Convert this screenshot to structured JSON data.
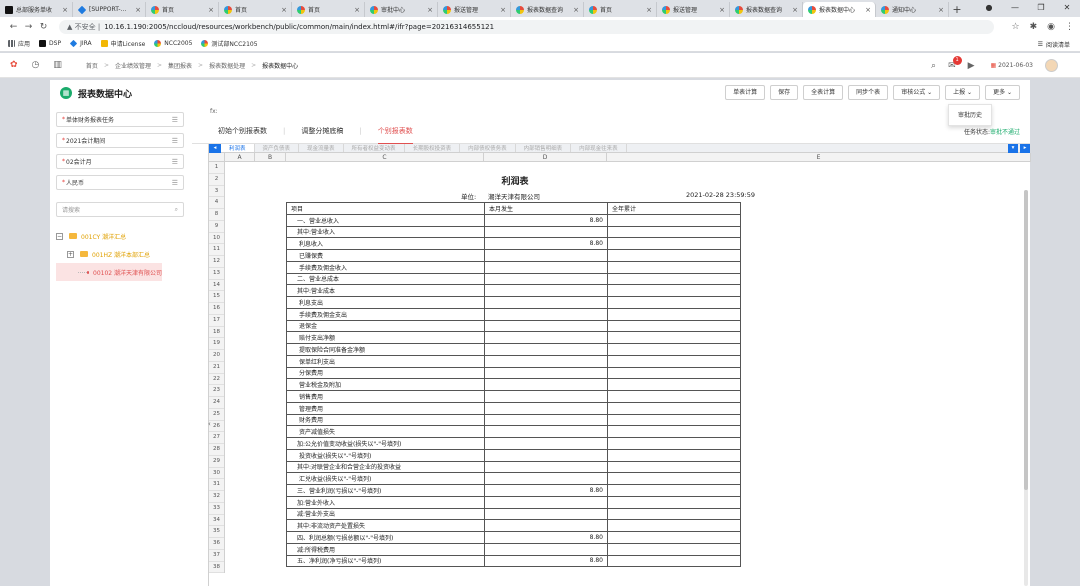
{
  "browser": {
    "tabs": [
      {
        "icon": "pm",
        "title": "总部服务单收"
      },
      {
        "icon": "sup",
        "title": "[SUPPORT-..."
      },
      {
        "icon": "ycs",
        "title": "首页"
      },
      {
        "icon": "ycs",
        "title": "首页"
      },
      {
        "icon": "ycs",
        "title": "首页"
      },
      {
        "icon": "ycs",
        "title": "审批中心"
      },
      {
        "icon": "ycs",
        "title": "报送管理"
      },
      {
        "icon": "ycs",
        "title": "报表数据查询"
      },
      {
        "icon": "ycs",
        "title": "首页"
      },
      {
        "icon": "ycs",
        "title": "报送管理"
      },
      {
        "icon": "ycs",
        "title": "报表数据查询"
      },
      {
        "icon": "ycs",
        "title": "报表数据中心",
        "active": true
      },
      {
        "icon": "ycs",
        "title": "通知中心"
      }
    ],
    "close_glyph": "×",
    "new_tab_glyph": "+",
    "url_warning": "▲ 不安全 |",
    "url": "10.16.1.190:2005/nccloud/resources/workbench/public/common/main/index.html#/ifr?page=20216314655121",
    "bookmarks": [
      {
        "icon": "apps",
        "label": "应用"
      },
      {
        "icon": "pm",
        "label": "DSP"
      },
      {
        "icon": "sup",
        "label": "JIRA"
      },
      {
        "icon": "yellow",
        "label": "申请License"
      },
      {
        "icon": "ycs",
        "label": "NCC2005"
      },
      {
        "icon": "ycs",
        "label": "测试部NCC2105"
      }
    ],
    "reading_list": "阅读清单"
  },
  "app": {
    "breadcrumbs": [
      "首页",
      "企业绩效管理",
      "集团报表",
      "报表数据处理",
      "报表数据中心"
    ],
    "notification_count": "1",
    "date": "2021-06-03"
  },
  "panel": {
    "title": "报表数据中心",
    "toolbar": [
      "单表计算",
      "保存",
      "全表计算",
      "同步个表",
      "审核公式 ⌄",
      "上报 ⌄",
      "更多 ⌄"
    ],
    "dropdown_item": "审批历史"
  },
  "sidebar": {
    "fields": [
      {
        "req": "*",
        "value": "单体财务报表任务"
      },
      {
        "req": "*",
        "value": "2021会计期间"
      },
      {
        "req": "*",
        "value": "02会计月"
      },
      {
        "req": "*",
        "value": "人民币"
      }
    ],
    "search_placeholder": "请搜索",
    "tree": [
      {
        "toggle": "−",
        "label": "001CY 潮洋汇总",
        "level": 0
      },
      {
        "toggle": "+",
        "label": "001HZ 潮洋本部汇总",
        "level": 1
      },
      {
        "toggle": "",
        "label": "00102 潮洋天津有限公司",
        "level": 2,
        "selected": true
      }
    ]
  },
  "content": {
    "fx_label": "fx:",
    "report_tabs": [
      "初始个别报表数",
      "调整分摊底稿",
      "个别报表数"
    ],
    "active_report_tab": 2,
    "task_status_label": "任务状态:",
    "task_status_value": "审批不通过",
    "sheet_tabs": [
      "利润表",
      "资产负债表",
      "现金流量表",
      "所有者权益变动表",
      "长期股权投资表",
      "内部债权债务表",
      "内部销售明细表",
      "内部现金往来表"
    ],
    "columns": [
      "A",
      "B",
      "C",
      "D",
      "E"
    ],
    "row_numbers": [
      "1",
      "2",
      "3",
      "4",
      "8",
      "9",
      "10",
      "11",
      "12",
      "13",
      "14",
      "15",
      "16",
      "17",
      "18",
      "19",
      "20",
      "21",
      "22",
      "23",
      "24",
      "25",
      "26",
      "27",
      "28",
      "29",
      "30",
      "31",
      "32",
      "33",
      "34",
      "35",
      "36",
      "37",
      "38"
    ]
  },
  "report": {
    "title": "利润表",
    "unit_label": "单位:",
    "unit_value": "潮洋天津有限公司",
    "datetime": "2021-02-28 23:59:59",
    "headers": [
      "项目",
      "本月发生",
      "全年累计"
    ],
    "rows": [
      [
        "一、营业总收入",
        "8.80",
        ""
      ],
      [
        "其中:营业收入",
        "",
        ""
      ],
      [
        "利息收入",
        "8.80",
        ""
      ],
      [
        "已赚保费",
        "",
        ""
      ],
      [
        "手续费及佣金收入",
        "",
        ""
      ],
      [
        "二、营业总成本",
        "",
        ""
      ],
      [
        "其中:营业成本",
        "",
        ""
      ],
      [
        "利息支出",
        "",
        ""
      ],
      [
        "手续费及佣金支出",
        "",
        ""
      ],
      [
        "退保金",
        "",
        ""
      ],
      [
        "赔付支出净额",
        "",
        ""
      ],
      [
        "提取保险合同准备金净额",
        "",
        ""
      ],
      [
        "保单红利支出",
        "",
        ""
      ],
      [
        "分保费用",
        "",
        ""
      ],
      [
        "营业税金及附加",
        "",
        ""
      ],
      [
        "销售费用",
        "",
        ""
      ],
      [
        "管理费用",
        "",
        ""
      ],
      [
        "财务费用",
        "",
        ""
      ],
      [
        "资产减值损失",
        "",
        ""
      ],
      [
        "加:公允价值变动收益(损失以\"-\"号填列)",
        "",
        ""
      ],
      [
        "投资收益(损失以\"-\"号填列)",
        "",
        ""
      ],
      [
        "其中:对联营企业和合营企业的投资收益",
        "",
        ""
      ],
      [
        "汇兑收益(损失以\"-\"号填列)",
        "",
        ""
      ],
      [
        "三、营业利润(亏损以\"-\"号填列)",
        "8.80",
        ""
      ],
      [
        "加:营业外收入",
        "",
        ""
      ],
      [
        "减:营业外支出",
        "",
        ""
      ],
      [
        "其中:非流动资产处置损失",
        "",
        ""
      ],
      [
        "四、利润总额(亏损总额以\"-\"号填列)",
        "8.80",
        ""
      ],
      [
        "减:所得税费用",
        "",
        ""
      ],
      [
        "五、净利润(净亏损以\"-\"号填列)",
        "8.80",
        ""
      ]
    ]
  }
}
